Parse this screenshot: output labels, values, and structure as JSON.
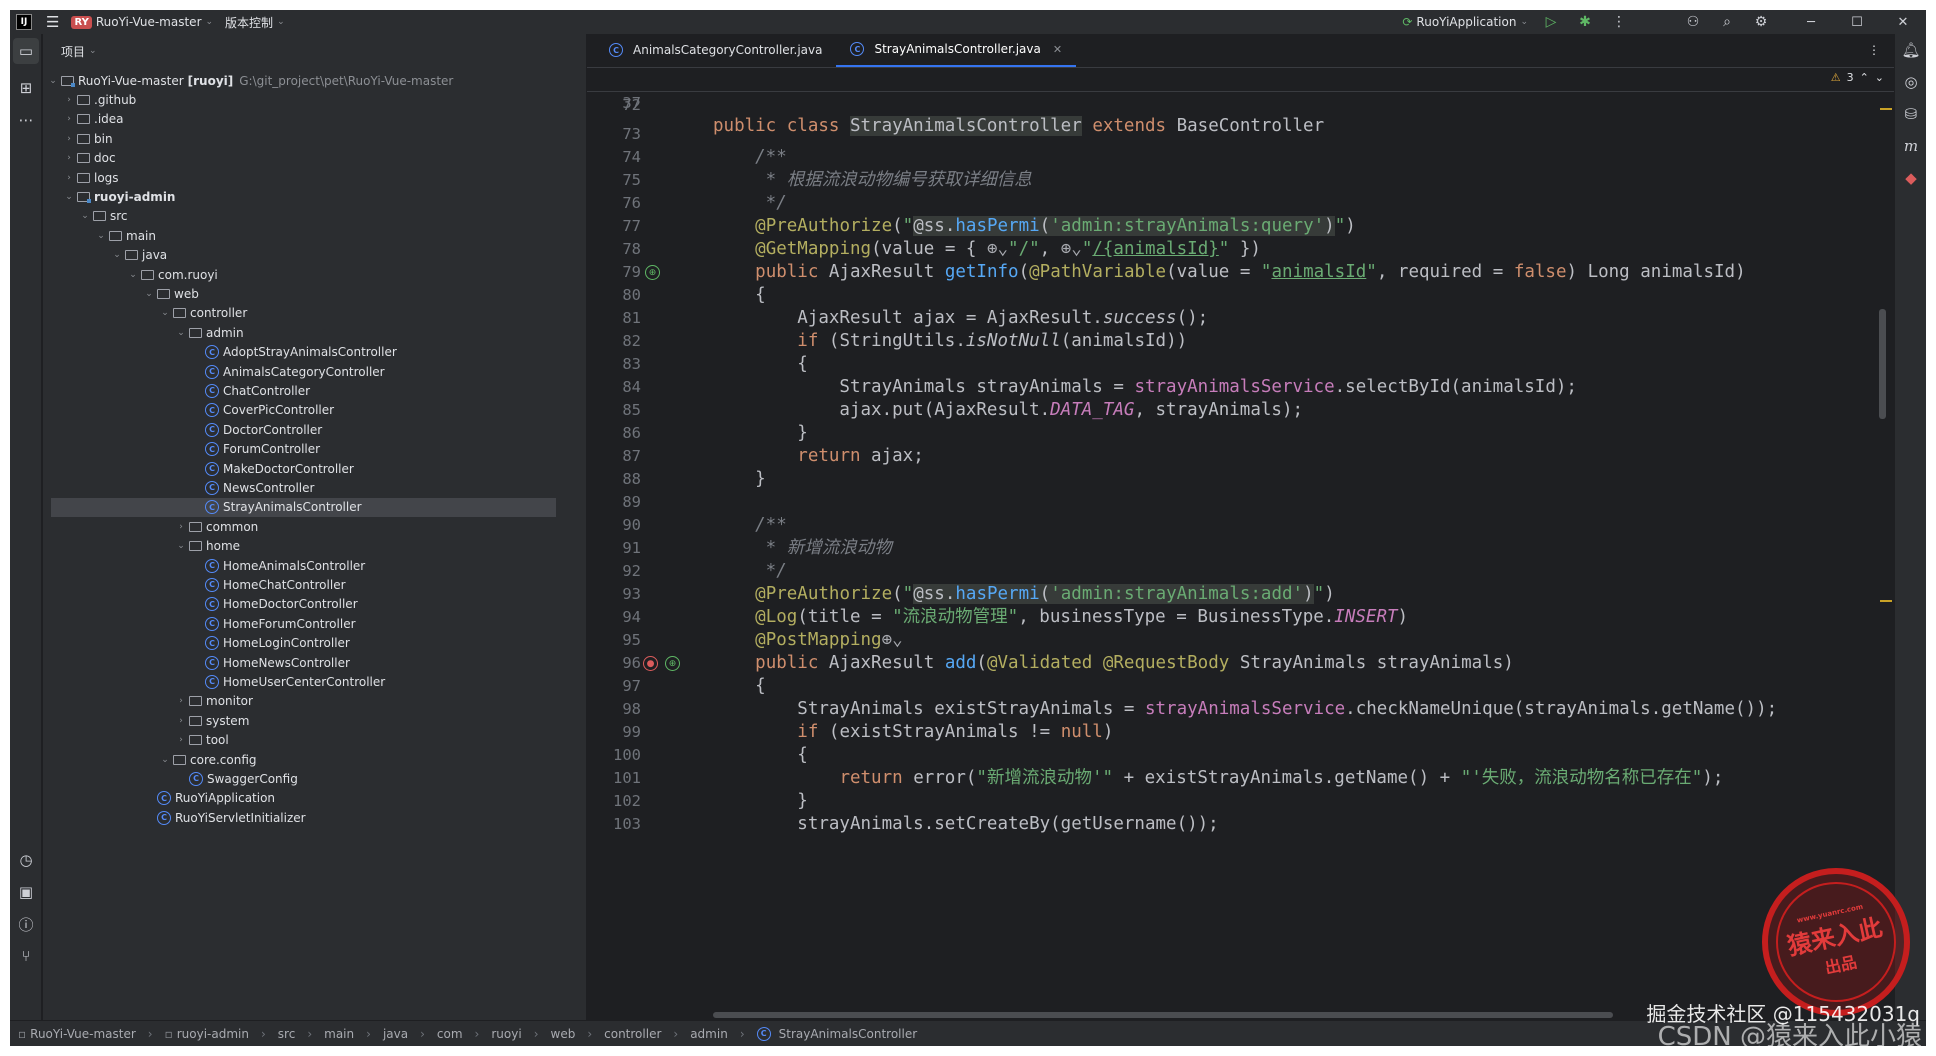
{
  "titlebar": {
    "app_badge": "IJ",
    "project_badge": "RY",
    "project_name": "RuoYi-Vue-master",
    "vcs_menu": "版本控制",
    "run_config": "RuoYiApplication"
  },
  "project_panel": {
    "title": "项目",
    "root_name": "RuoYi-Vue-master",
    "root_module": "[ruoyi]",
    "root_path": "G:\\git_project\\pet\\RuoYi-Vue-master",
    "tree": [
      {
        "label": ".github",
        "depth": 1,
        "type": "folder",
        "expanded": false
      },
      {
        "label": ".idea",
        "depth": 1,
        "type": "folder",
        "expanded": false
      },
      {
        "label": "bin",
        "depth": 1,
        "type": "folder",
        "expanded": false
      },
      {
        "label": "doc",
        "depth": 1,
        "type": "folder",
        "expanded": false
      },
      {
        "label": "logs",
        "depth": 1,
        "type": "folder",
        "expanded": false
      },
      {
        "label": "ruoyi-admin",
        "depth": 1,
        "type": "module",
        "expanded": true
      },
      {
        "label": "src",
        "depth": 2,
        "type": "folder",
        "expanded": true
      },
      {
        "label": "main",
        "depth": 3,
        "type": "folder",
        "expanded": true
      },
      {
        "label": "java",
        "depth": 4,
        "type": "folder",
        "expanded": true
      },
      {
        "label": "com.ruoyi",
        "depth": 5,
        "type": "folder",
        "expanded": true
      },
      {
        "label": "web",
        "depth": 6,
        "type": "folder",
        "expanded": true
      },
      {
        "label": "controller",
        "depth": 7,
        "type": "folder",
        "expanded": true
      },
      {
        "label": "admin",
        "depth": 8,
        "type": "folder",
        "expanded": true
      },
      {
        "label": "AdoptStrayAnimalsController",
        "depth": 9,
        "type": "class"
      },
      {
        "label": "AnimalsCategoryController",
        "depth": 9,
        "type": "class"
      },
      {
        "label": "ChatController",
        "depth": 9,
        "type": "class"
      },
      {
        "label": "CoverPicController",
        "depth": 9,
        "type": "class"
      },
      {
        "label": "DoctorController",
        "depth": 9,
        "type": "class"
      },
      {
        "label": "ForumController",
        "depth": 9,
        "type": "class"
      },
      {
        "label": "MakeDoctorController",
        "depth": 9,
        "type": "class"
      },
      {
        "label": "NewsController",
        "depth": 9,
        "type": "class"
      },
      {
        "label": "StrayAnimalsController",
        "depth": 9,
        "type": "class",
        "selected": true
      },
      {
        "label": "common",
        "depth": 8,
        "type": "folder",
        "expanded": false
      },
      {
        "label": "home",
        "depth": 8,
        "type": "folder",
        "expanded": true
      },
      {
        "label": "HomeAnimalsController",
        "depth": 9,
        "type": "class"
      },
      {
        "label": "HomeChatController",
        "depth": 9,
        "type": "class"
      },
      {
        "label": "HomeDoctorController",
        "depth": 9,
        "type": "class"
      },
      {
        "label": "HomeForumController",
        "depth": 9,
        "type": "class"
      },
      {
        "label": "HomeLoginController",
        "depth": 9,
        "type": "class"
      },
      {
        "label": "HomeNewsController",
        "depth": 9,
        "type": "class"
      },
      {
        "label": "HomeUserCenterController",
        "depth": 9,
        "type": "class"
      },
      {
        "label": "monitor",
        "depth": 8,
        "type": "folder",
        "expanded": false
      },
      {
        "label": "system",
        "depth": 8,
        "type": "folder",
        "expanded": false
      },
      {
        "label": "tool",
        "depth": 8,
        "type": "folder",
        "expanded": false
      },
      {
        "label": "core.config",
        "depth": 7,
        "type": "folder",
        "expanded": true
      },
      {
        "label": "SwaggerConfig",
        "depth": 8,
        "type": "class"
      },
      {
        "label": "RuoYiApplication",
        "depth": 6,
        "type": "appclass"
      },
      {
        "label": "RuoYiServletInitializer",
        "depth": 6,
        "type": "class"
      }
    ]
  },
  "editor": {
    "tabs": [
      {
        "label": "AnimalsCategoryController.java",
        "active": false
      },
      {
        "label": "StrayAnimalsController.java",
        "active": true
      }
    ],
    "warning_count": "3",
    "sticky_line": {
      "num": "37"
    },
    "line_numbers": [
      "72",
      "73",
      "74",
      "75",
      "76",
      "77",
      "78",
      "79",
      "80",
      "81",
      "82",
      "83",
      "84",
      "85",
      "86",
      "87",
      "88",
      "89",
      "90",
      "91",
      "92",
      "93",
      "94",
      "95",
      "96",
      "97",
      "98",
      "99",
      "100",
      "101",
      "102",
      "103"
    ]
  },
  "statusbar": {
    "breadcrumbs": [
      "RuoYi-Vue-master",
      "ruoyi-admin",
      "src",
      "main",
      "java",
      "com",
      "ruoyi",
      "web",
      "controller",
      "admin",
      "StrayAnimalsController"
    ]
  },
  "watermark": {
    "text": "CSDN @猿来入此小猿",
    "text2": "掘金技术社区 @115432031q",
    "stamp_url": "www.yuanrc.com",
    "stamp_main": "猿来入此",
    "stamp_sub": "出品"
  }
}
